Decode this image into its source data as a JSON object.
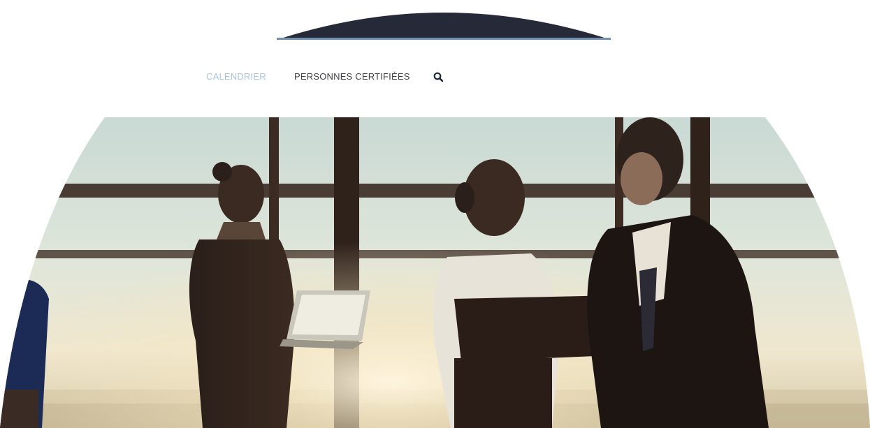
{
  "nav": {
    "items": [
      {
        "label": "CALENDRIER",
        "state": "active"
      },
      {
        "label": "PERSONNES CERTIFIÉES",
        "state": "default"
      }
    ],
    "search_icon": "search-icon"
  },
  "hero": {
    "image": "business-people-meeting-by-office-window"
  },
  "colors": {
    "dome": "#262a38",
    "dome_accent": "#6f8fb3",
    "nav_active": "#a9c4db",
    "nav_default": "#3c3f45",
    "icon": "#1f2a3a"
  }
}
